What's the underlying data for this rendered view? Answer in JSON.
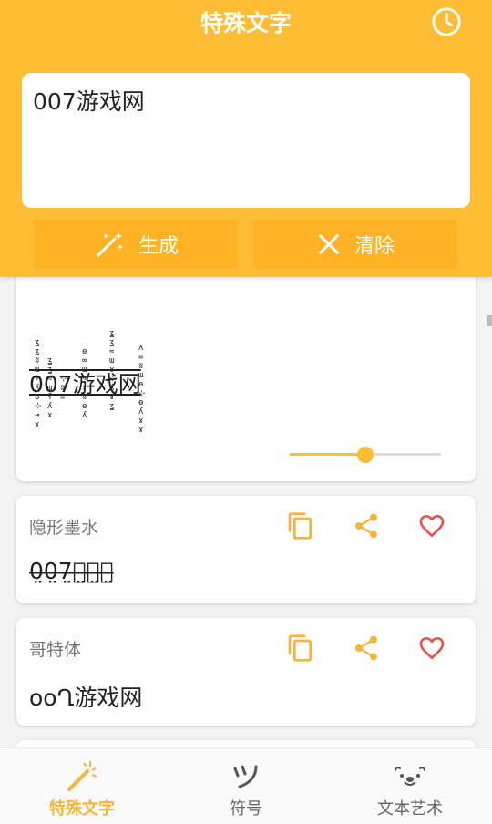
{
  "header": {
    "title": "特殊文字",
    "input_value": "007游戏网",
    "generate_label": "生成",
    "clear_label": "清除"
  },
  "cards": [
    {
      "label": "",
      "preview": "007游戏网",
      "slider_value": 0.5
    },
    {
      "label": "隐形墨水",
      "preview": "0̶̤0̶̤7̶̤游̶̤戏̶̤网̶̤"
    },
    {
      "label": "哥特体",
      "preview": "ooՂ游戏网"
    }
  ],
  "bottom_nav": [
    {
      "label": "特殊文字",
      "active": true
    },
    {
      "label": "符号",
      "active": false
    },
    {
      "label": "文本艺术",
      "active": false
    }
  ],
  "colors": {
    "accent": "#ffbc35",
    "icon": "#f5b53b",
    "heart": "#e5534b"
  }
}
